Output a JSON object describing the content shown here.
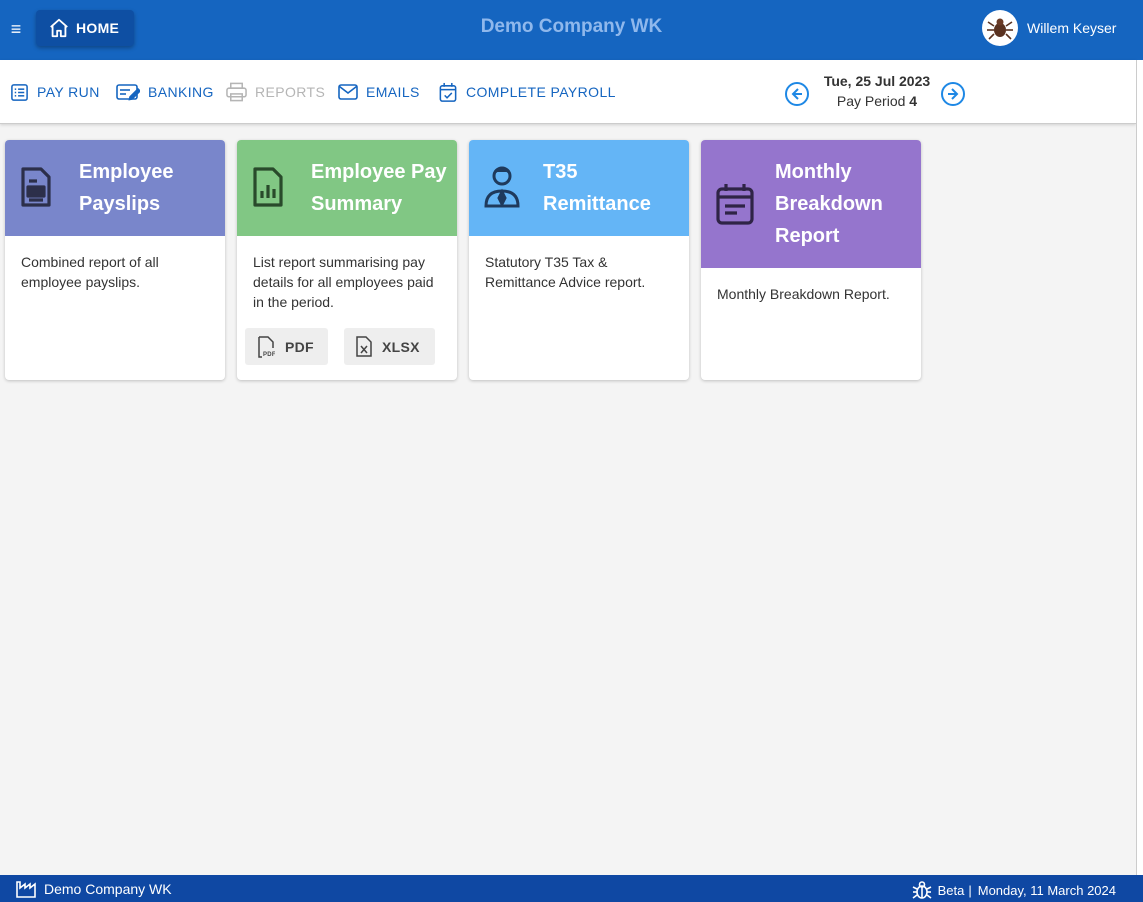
{
  "header": {
    "menu_icon": "hamburger-icon",
    "home_label": "HOME",
    "company_title": "Demo Company WK",
    "user_name": "Willem Keyser"
  },
  "toolbar": {
    "items": [
      {
        "label": "PAY RUN",
        "icon": "list-icon",
        "enabled": true
      },
      {
        "label": "BANKING",
        "icon": "edit-icon",
        "enabled": true
      },
      {
        "label": "REPORTS",
        "icon": "printer-icon",
        "enabled": false
      },
      {
        "label": "EMAILS",
        "icon": "envelope-icon",
        "enabled": true
      },
      {
        "label": "COMPLETE PAYROLL",
        "icon": "calendar-check-icon",
        "enabled": true
      }
    ],
    "period": {
      "date": "Tue, 25 Jul 2023",
      "label": "Pay Period",
      "number": "4"
    }
  },
  "cards": [
    {
      "title": "Employee Payslips",
      "description": "Combined report of all employee payslips.",
      "color": "#7986cb",
      "icon": "document-icon"
    },
    {
      "title": "Employee Pay Summary",
      "description": "List report summarising pay details for all employees paid in the period.",
      "color": "#81c784",
      "icon": "report-chart-icon",
      "buttons": [
        {
          "label": "PDF",
          "icon": "pdf-file-icon"
        },
        {
          "label": "XLSX",
          "icon": "xlsx-file-icon"
        }
      ]
    },
    {
      "title": "T35 Remittance",
      "description": "Statutory T35 Tax & Remittance Advice report.",
      "color": "#64b5f6",
      "icon": "person-tie-icon"
    },
    {
      "title": "Monthly Breakdown Report",
      "description": "Monthly Breakdown Report.",
      "color": "#9575cd",
      "icon": "calendar-icon"
    }
  ],
  "footer": {
    "company": "Demo Company WK",
    "beta_label": "Beta",
    "date": "Monday, 11 March 2024"
  },
  "colors": {
    "primary": "#1565c0",
    "footer": "#0f48a3",
    "disabled": "#b5b5b5"
  }
}
